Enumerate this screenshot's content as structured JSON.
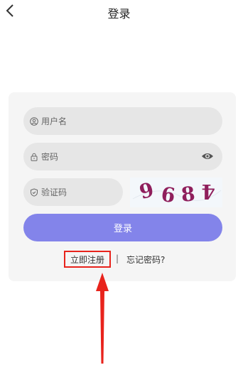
{
  "header": {
    "title": "登录"
  },
  "form": {
    "username_placeholder": "用户名",
    "password_placeholder": "密码",
    "captcha_placeholder": "验证码",
    "captcha_text": "9684",
    "login_label": "登录"
  },
  "links": {
    "register": "立即注册",
    "separator": "|",
    "forgot": "忘记密码?"
  },
  "colors": {
    "accent": "#8384ea",
    "highlight": "#e8231c",
    "captcha_text": "#8f1f5c"
  },
  "icons": [
    "back-chevron-icon",
    "user-icon",
    "lock-icon",
    "eye-icon",
    "shield-icon",
    "annotation-arrow"
  ]
}
